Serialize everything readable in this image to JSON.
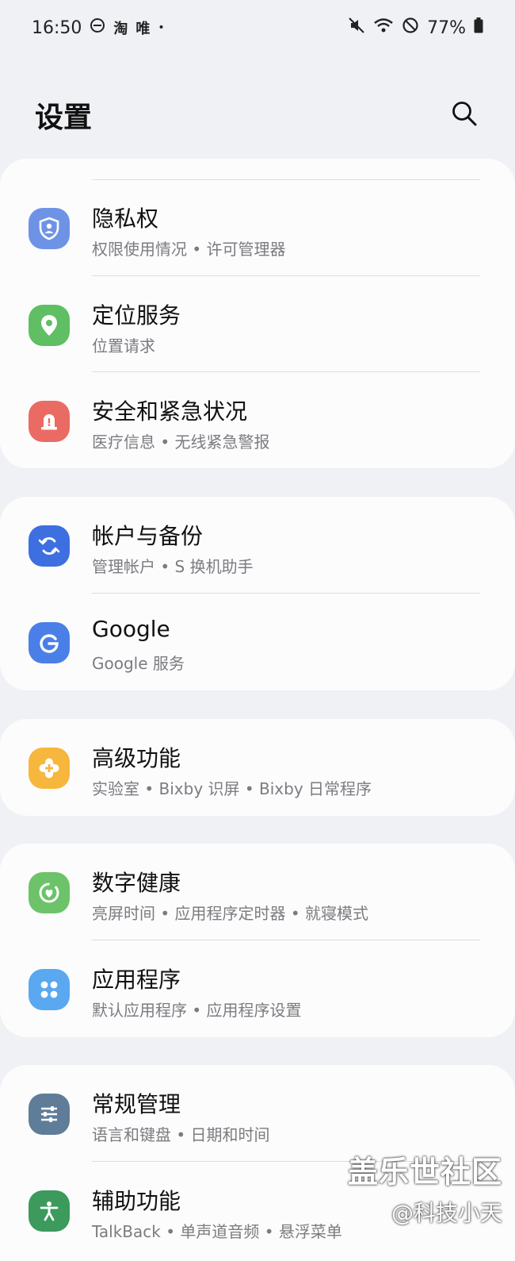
{
  "status_bar": {
    "time": "16:50",
    "app1": "淘",
    "app2": "唯",
    "dot": "•",
    "battery": "77%"
  },
  "header": {
    "title": "设置"
  },
  "groups": [
    {
      "items": [
        {
          "title": "隐私权",
          "subtitle": "权限使用情况 • 许可管理器",
          "icon": "privacy-shield-icon",
          "color": "#6e93e6"
        },
        {
          "title": "定位服务",
          "subtitle": "位置请求",
          "icon": "location-pin-icon",
          "color": "#5fbf62"
        },
        {
          "title": "安全和紧急状况",
          "subtitle": "医疗信息 • 无线紧急警报",
          "icon": "emergency-alert-icon",
          "color": "#ea6b63"
        }
      ]
    },
    {
      "items": [
        {
          "title": "帐户与备份",
          "subtitle": "管理帐户 • S 换机助手",
          "icon": "sync-icon",
          "color": "#3d6fe0"
        },
        {
          "title": "Google",
          "subtitle": "Google 服务",
          "icon": "google-icon",
          "color": "#4a7fe8"
        }
      ]
    },
    {
      "items": [
        {
          "title": "高级功能",
          "subtitle": "实验室 • Bixby 识屏 • Bixby 日常程序",
          "icon": "puzzle-plus-icon",
          "color": "#f7b63c"
        }
      ]
    },
    {
      "items": [
        {
          "title": "数字健康",
          "subtitle": "亮屏时间 • 应用程序定时器 • 就寝模式",
          "icon": "heart-ring-icon",
          "color": "#6cc36a"
        },
        {
          "title": "应用程序",
          "subtitle": "默认应用程序 • 应用程序设置",
          "icon": "apps-grid-icon",
          "color": "#5aa8f0"
        }
      ]
    },
    {
      "items": [
        {
          "title": "常规管理",
          "subtitle": "语言和键盘 • 日期和时间",
          "icon": "sliders-icon",
          "color": "#5f7d98"
        },
        {
          "title": "辅助功能",
          "subtitle": "TalkBack • 单声道音频 • 悬浮菜单",
          "icon": "accessibility-person-icon",
          "color": "#3b9a5c"
        }
      ]
    }
  ],
  "watermark": {
    "brand": "盖乐世社区",
    "handle": "@科技小天"
  }
}
